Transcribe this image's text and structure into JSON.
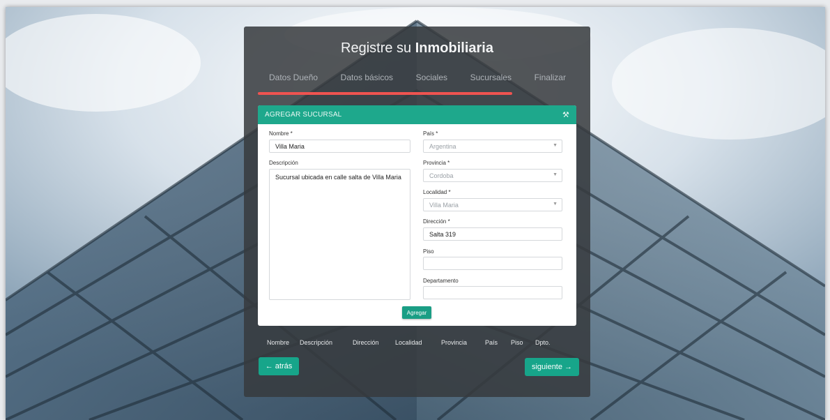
{
  "header": {
    "title_prefix": "Registre su ",
    "title_bold": "Inmobiliaria"
  },
  "steps": [
    "Datos Dueño",
    "Datos básicos",
    "Sociales",
    "Sucursales",
    "Finalizar"
  ],
  "progress_fraction": 0.8,
  "card": {
    "title": "AGREGAR SUCURSAL",
    "tool_icon": "tools-icon"
  },
  "form": {
    "nombre_label": "Nombre *",
    "nombre_value": "Villa Maria",
    "descripcion_label": "Descripción",
    "descripcion_value": "Sucursal ubicada en calle salta de Villa Maria",
    "pais_label": "País *",
    "pais_value": "Argentina",
    "provincia_label": "Provincia *",
    "provincia_value": "Cordoba",
    "localidad_label": "Localidad *",
    "localidad_value": "Villa Maria",
    "direccion_label": "Dirección *",
    "direccion_value": "Salta 319",
    "piso_label": "Piso",
    "piso_value": "",
    "departamento_label": "Departamento",
    "departamento_value": "",
    "submit_label": "Agregar"
  },
  "table": {
    "columns": [
      "Nombre",
      "Descripción",
      "Dirección",
      "Localidad",
      "Provincia",
      "País",
      "Piso",
      "Dpto."
    ]
  },
  "nav": {
    "back_label": "← atrás",
    "next_label": "siguiente →"
  },
  "colors": {
    "accent": "#1ea88c",
    "progress": "#ef5350",
    "panel": "#373a3e"
  }
}
